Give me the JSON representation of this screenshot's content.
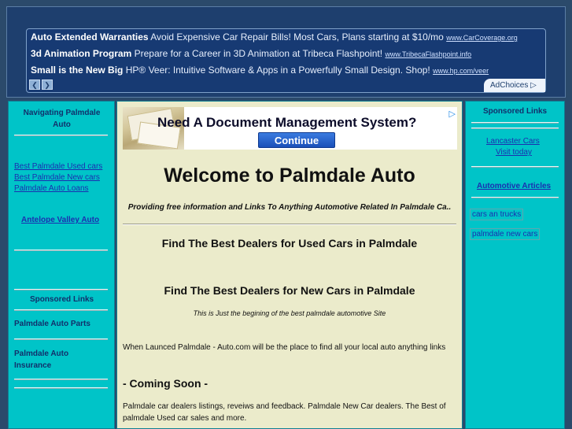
{
  "ads": {
    "lines": [
      {
        "title": "Auto Extended Warranties",
        "text": "Avoid Expensive Car Repair Bills! Most Cars, Plans starting at $10/mo",
        "url": "www.CarCoverage.org"
      },
      {
        "title": "3d Animation Program",
        "text": "Prepare for a Career in 3D Animation at Tribeca Flashpoint!",
        "url": "www.TribecaFlashpoint.info"
      },
      {
        "title": "Small is the New Big",
        "text": "HP® Veer: Intuitive Software & Apps in a Powerfully Small Design. Shop!",
        "url": "www.hp.com/veer"
      }
    ],
    "prev_glyph": "❮",
    "next_glyph": "❯",
    "adchoices_label": "AdChoices ▷"
  },
  "left": {
    "heading": "Navigating Palmdale Auto",
    "links": [
      "Best Palmdale Used cars",
      "Best Palmdale New cars",
      "Palmdale Auto Loans"
    ],
    "antelope": "Antelope Valley Auto",
    "sponsored_heading": "Sponsored Links",
    "parts": "Palmdale Auto Parts",
    "insurance": "Palmdale Auto Insurance"
  },
  "right": {
    "heading": "Sponsored Links",
    "lancaster": "Lancaster Cars",
    "visit": "Visit today",
    "articles": "Automotive Articles",
    "box1": "cars an trucks",
    "box2": "palmdale new cars"
  },
  "banner": {
    "title": "Need A Document Management System?",
    "button": "Continue",
    "ad_icon": "▷"
  },
  "main": {
    "title": "Welcome to Palmdale Auto",
    "tagline": "Providing free information and Links To Anything Automotive Related In Palmdale Ca..",
    "used_heading": "Find The Best Dealers for Used Cars in Palmdale",
    "new_heading": "Find The Best Dealers for New Cars in Palmdale",
    "note": "This is Just the begining of the best palmdale automotive Site",
    "launched": "When Launced Palmdale - Auto.com will be the place to find all your local auto anything links",
    "coming_soon": "- Coming Soon -",
    "listings": "Palmdale car dealers listings, reveiws and feedback. Palmdale New Car dealers. The Best of palmdale Used car sales and more."
  },
  "colors": {
    "page_bg": "#2b4a6b",
    "sidebar_bg": "#00c4c8",
    "main_bg": "#ebebcb",
    "ad_bg": "#173a73",
    "link": "#1b2fb0"
  }
}
